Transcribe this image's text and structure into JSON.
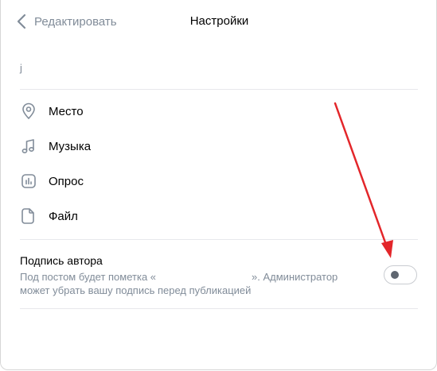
{
  "header": {
    "back_label": "Редактировать",
    "title": "Настройки"
  },
  "text_field": {
    "value": "j"
  },
  "menu": {
    "items": [
      {
        "label": "Место",
        "icon": "location-pin-icon"
      },
      {
        "label": "Музыка",
        "icon": "music-note-icon"
      },
      {
        "label": "Опрос",
        "icon": "poll-icon"
      },
      {
        "label": "Файл",
        "icon": "file-icon"
      }
    ]
  },
  "signature": {
    "title": "Подпись автора",
    "desc_part1": "Под постом будет пометка «",
    "desc_part2": "». Администратор может убрать вашу подпись перед публикацией",
    "toggle_on": false
  },
  "colors": {
    "accent_arrow": "#e3262a",
    "secondary_text": "#818c99",
    "divider": "#e7e8ec"
  }
}
